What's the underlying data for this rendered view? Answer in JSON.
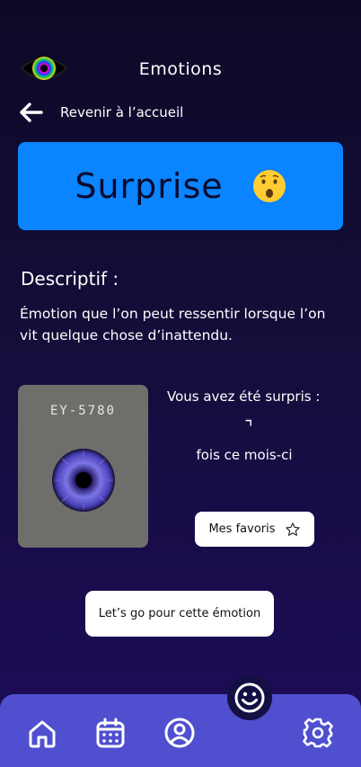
{
  "header": {
    "logo_icon": "rainbow-eye-icon",
    "title": "Emotions"
  },
  "back": {
    "icon": "arrow-left-icon",
    "label": "Revenir à l’accueil"
  },
  "emotion": {
    "name": "Surprise",
    "emoji_icon": "surprised-face-emoji",
    "banner_color": "#0a84ff"
  },
  "description": {
    "title": "Descriptif :",
    "text": "Émotion que l’on peut ressentir lorsque l’on vit quelque chose d’inattendu."
  },
  "card": {
    "code": "EY-5780",
    "image_icon": "blue-iris-icon"
  },
  "stats": {
    "label": "Vous avez été surpris :",
    "value": "⌝",
    "suffix": "fois ce mois-ci"
  },
  "favorites_button": {
    "label": "Mes favoris",
    "icon": "star-outline-icon"
  },
  "action_button": {
    "label": "Let’s go pour cette émotion"
  },
  "navbar": {
    "color": "#4f4fcf",
    "items": [
      {
        "icon": "home-icon"
      },
      {
        "icon": "calendar-icon"
      },
      {
        "icon": "profile-icon"
      },
      {
        "icon": "smiley-icon"
      },
      {
        "icon": "settings-gear-icon"
      }
    ]
  }
}
